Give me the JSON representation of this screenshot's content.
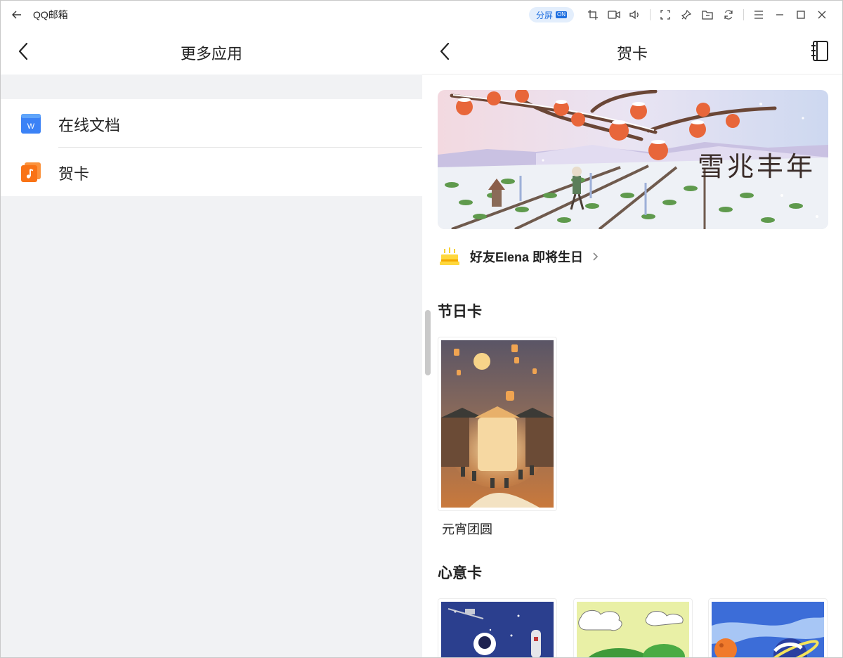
{
  "app": {
    "title": "QQ邮箱",
    "split_label": "分屏",
    "split_badge": "ON",
    "toolbar_icons": [
      "crop-icon",
      "video-icon",
      "volume-icon",
      "fullscreen-icon",
      "pin-icon",
      "folder-icon",
      "refresh-icon",
      "menu-icon",
      "minimize-icon",
      "maximize-icon",
      "close-icon"
    ]
  },
  "left": {
    "title": "更多应用",
    "items": [
      {
        "label": "在线文档",
        "icon": "online-doc-icon",
        "color": "#3b82f6"
      },
      {
        "label": "贺卡",
        "icon": "greeting-card-icon",
        "color": "#f97316"
      }
    ]
  },
  "right": {
    "title": "贺卡",
    "banner": {
      "text": "雪兆丰年"
    },
    "birthday": {
      "text": "好友Elena 即将生日"
    },
    "sections": [
      {
        "title": "节日卡",
        "cards": [
          {
            "caption": "元宵团圆"
          }
        ]
      },
      {
        "title": "心意卡",
        "cards": [
          {
            "caption": ""
          },
          {
            "caption": ""
          },
          {
            "caption": ""
          }
        ]
      }
    ]
  },
  "colors": {
    "accent": "#1e6fe0",
    "pane_bg": "#f1f2f4",
    "persimmon": "#e8663a"
  }
}
